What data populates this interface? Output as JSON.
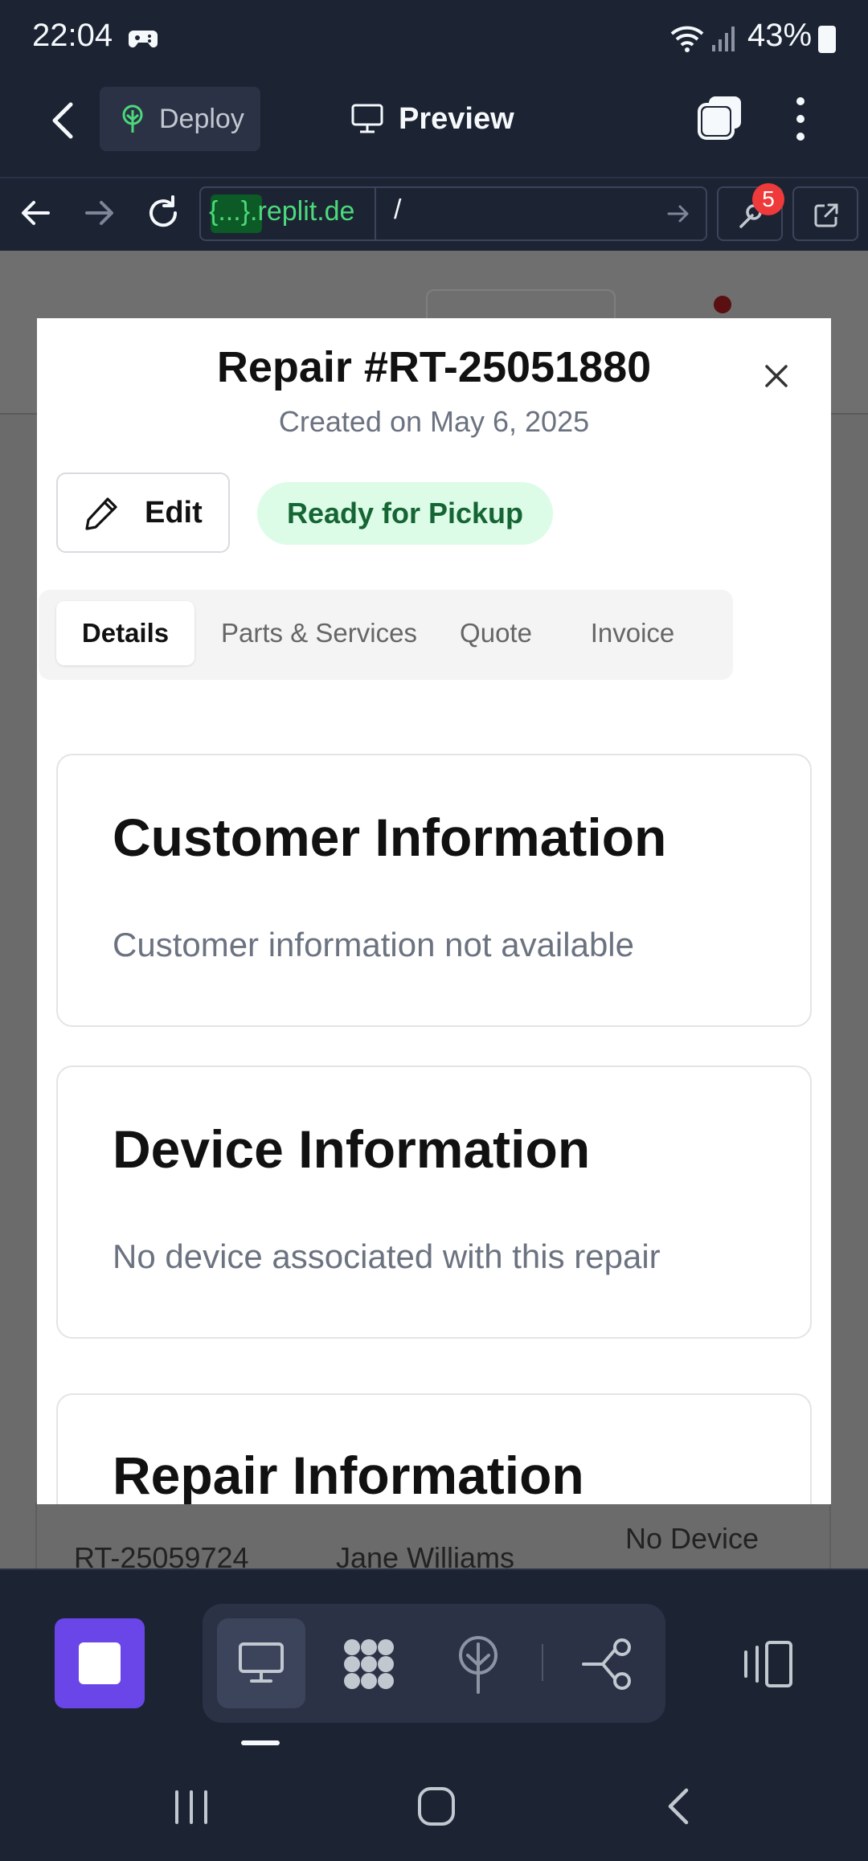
{
  "status_bar": {
    "time": "22:04",
    "battery": "43%",
    "icons": [
      "game-controller-icon",
      "wifi-icon",
      "signal-icon",
      "battery-icon"
    ]
  },
  "app_bar": {
    "deploy_label": "Deploy",
    "preview_label": "Preview",
    "icons": [
      "back-chevron-icon",
      "deploy-tree-icon",
      "monitor-icon",
      "tabs-icon",
      "more-vertical-icon"
    ]
  },
  "browser_bar": {
    "url_host": "{...}.replit.de",
    "url_path": "/",
    "devtools_badge": "5",
    "icons": [
      "arrow-left-icon",
      "arrow-right-icon",
      "reload-icon",
      "arrow-right-small-icon",
      "wrench-icon",
      "open-external-icon"
    ]
  },
  "background_page": {
    "row": {
      "id": "RT-25059724",
      "customer": "Jane Williams",
      "device": "No Device"
    }
  },
  "modal": {
    "title": "Repair #RT-25051880",
    "subtitle": "Created on May 6, 2025",
    "edit_label": "Edit",
    "status": "Ready for Pickup",
    "tabs": [
      {
        "label": "Details",
        "active": true
      },
      {
        "label": "Parts & Services",
        "active": false
      },
      {
        "label": "Quote",
        "active": false
      },
      {
        "label": "Invoice",
        "active": false
      }
    ],
    "cards": {
      "customer": {
        "title": "Customer Information",
        "text": "Customer information not available"
      },
      "device": {
        "title": "Device Information",
        "text": "No device associated with this repair"
      },
      "repair": {
        "title": "Repair Information"
      }
    }
  },
  "bottom_toolbar": {
    "icons": [
      "stop-icon",
      "monitor-icon",
      "puzzle-icon",
      "deploy-tree-icon",
      "git-branch-icon",
      "split-panel-icon"
    ]
  },
  "colors": {
    "chrome_bg": "#1c2333",
    "accent_purple": "#6a46e8",
    "status_green_bg": "#dcfce7",
    "status_green_text": "#166534",
    "badge_red": "#ee3a3a"
  }
}
